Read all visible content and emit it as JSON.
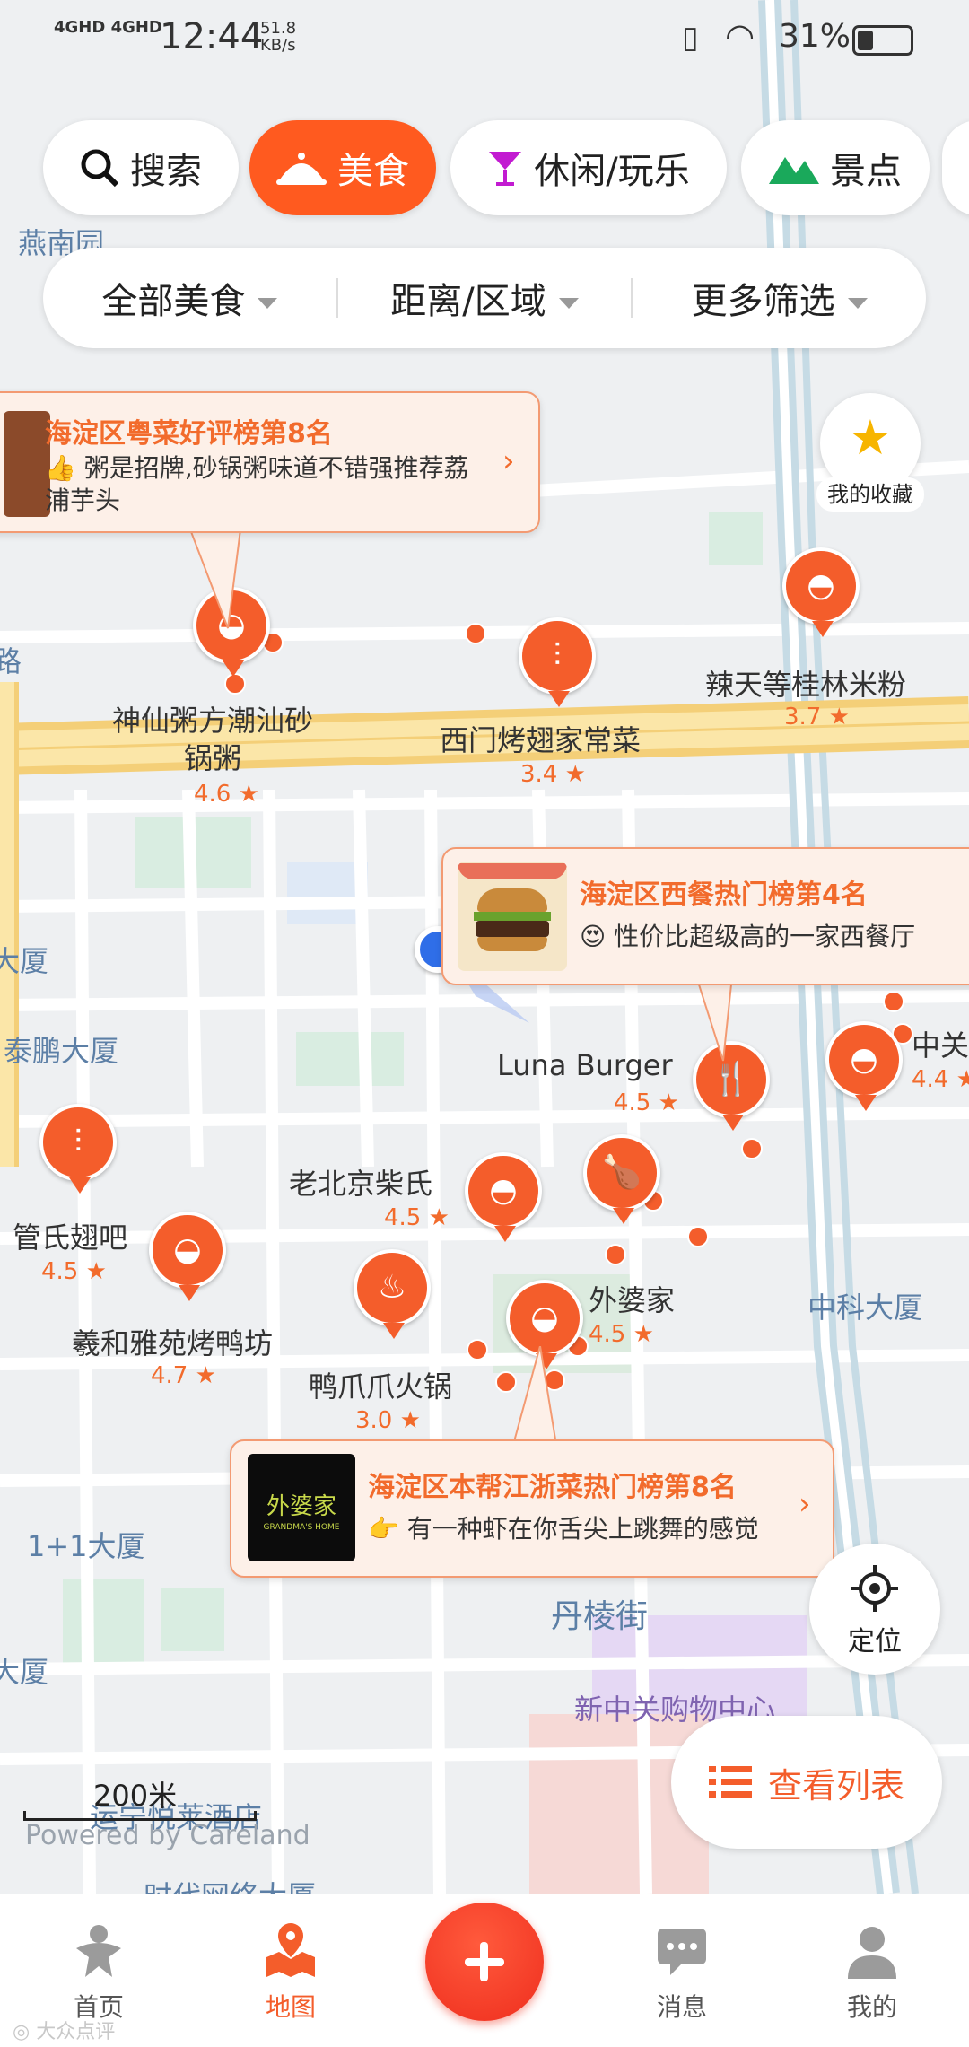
{
  "status_bar": {
    "network": "4GHD 4GHD",
    "time": "12:44",
    "speed": "51.8",
    "speed_unit": "KB/s",
    "battery": "31%",
    "battery_level": 0.31
  },
  "chips": [
    {
      "label": "搜索",
      "icon": "search-icon"
    },
    {
      "label": "美食",
      "icon": "food-dish-icon",
      "active": true
    },
    {
      "label": "休闲/玩乐",
      "icon": "cocktail-icon"
    },
    {
      "label": "景点",
      "icon": "mountain-icon"
    }
  ],
  "filters": [
    "全部美食",
    "距离/区域",
    "更多筛选"
  ],
  "popups": [
    {
      "title": "海淀区粤菜好评榜第8名",
      "emoji": "👍",
      "desc": "粥是招牌,砂锅粥味道不错强推荐荔浦芋头"
    },
    {
      "title": "海淀区西餐热门榜第4名",
      "emoji": "😍",
      "desc": "性价比超级高的一家西餐厅"
    },
    {
      "title": "海淀区本帮江浙菜热门榜第8名",
      "emoji": "👉",
      "desc": "有一种虾在你舌尖上跳舞的感觉",
      "logo_text": "外婆家",
      "logo_sub": "GRANDMA'S HOME"
    }
  ],
  "restaurants": [
    {
      "name_lines": [
        "神仙粥方潮汕砂",
        "锅粥"
      ],
      "rating": "4.6"
    },
    {
      "name": "西门烤翅家常菜",
      "rating": "3.4"
    },
    {
      "name": "辣天等桂林米粉",
      "rating": "3.7"
    },
    {
      "name": "Luna Burger",
      "rating": "4.5"
    },
    {
      "name": "老北京柴氏",
      "rating": "4.5"
    },
    {
      "name": "管氏翅吧",
      "rating": "4.5"
    },
    {
      "name": "羲和雅苑烤鸭坊",
      "rating": "4.7"
    },
    {
      "name": "鸭爪爪火锅",
      "rating": "3.0"
    },
    {
      "name": "外婆家",
      "rating": "4.5"
    },
    {
      "name": "中关",
      "rating": "4.4"
    }
  ],
  "map_labels": [
    "燕南园",
    "大厦",
    "泰鹏大厦",
    "中科大厦",
    "1+1大厦",
    "丹棱街",
    "大厦",
    "新中关购物中心",
    "运宁悦莱酒店",
    "时代网络大厦",
    "路"
  ],
  "favorites_label": "我的收藏",
  "locate_label": "定位",
  "list_button": "查看列表",
  "scale": "200米",
  "powered": "Powered by Careland",
  "nav": [
    {
      "label": "首页",
      "icon": "home-icon"
    },
    {
      "label": "地图",
      "icon": "map-pin-icon",
      "active": true
    },
    {
      "label": "",
      "icon": "plus-icon"
    },
    {
      "label": "消息",
      "icon": "message-icon"
    },
    {
      "label": "我的",
      "icon": "profile-icon"
    }
  ],
  "watermark": "大众点评"
}
